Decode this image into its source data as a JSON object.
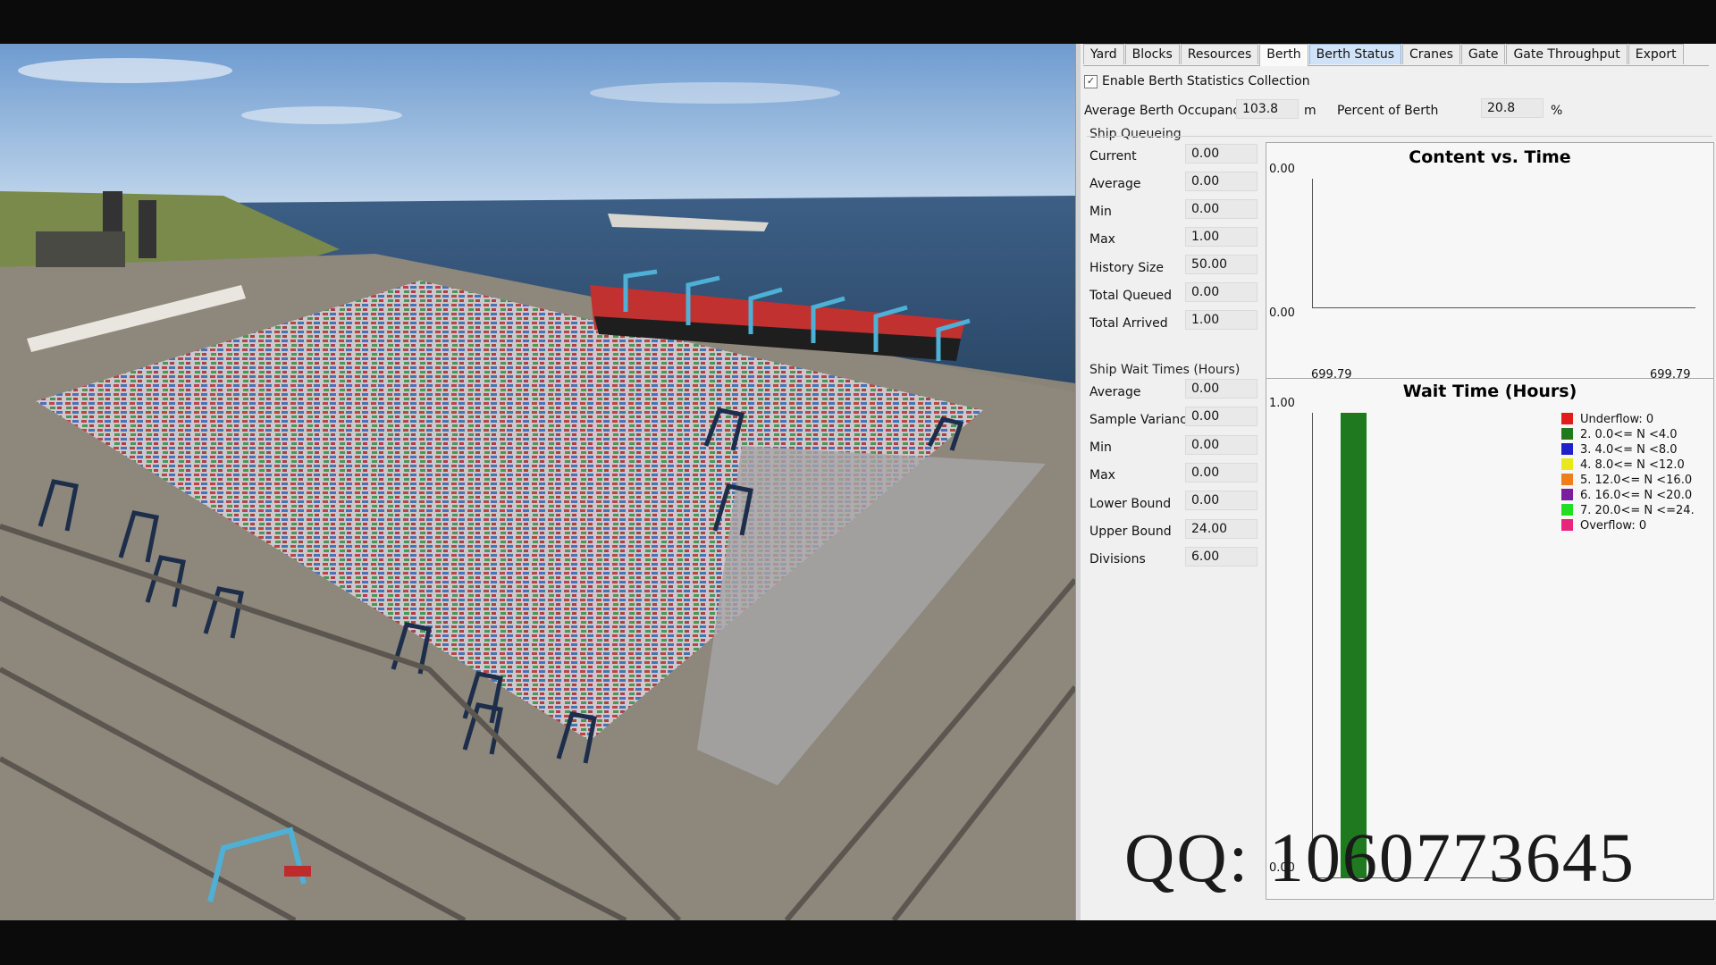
{
  "tabs": [
    {
      "label": "Yard"
    },
    {
      "label": "Blocks"
    },
    {
      "label": "Resources"
    },
    {
      "label": "Berth"
    },
    {
      "label": "Berth Status"
    },
    {
      "label": "Cranes"
    },
    {
      "label": "Gate"
    },
    {
      "label": "Gate Throughput"
    },
    {
      "label": "Export"
    }
  ],
  "enable": {
    "checked_glyph": "✓",
    "label": "Enable Berth Statistics Collection"
  },
  "occupancy": {
    "label": "Average Berth Occupancy",
    "value": "103.8",
    "unit": "m",
    "percent_label": "Percent of Berth",
    "percent_value": "20.8",
    "percent_unit": "%"
  },
  "queueing": {
    "title": "Ship Queueing",
    "rows": [
      {
        "label": "Current",
        "value": "0.00"
      },
      {
        "label": "Average",
        "value": "0.00"
      },
      {
        "label": "Min",
        "value": "0.00"
      },
      {
        "label": "Max",
        "value": "1.00"
      },
      {
        "label": "History Size",
        "value": "50.00"
      },
      {
        "label": "Total Queued",
        "value": "0.00"
      },
      {
        "label": "Total Arrived",
        "value": "1.00"
      }
    ]
  },
  "wait": {
    "title": "Ship Wait Times (Hours)",
    "rows": [
      {
        "label": "Average",
        "value": "0.00"
      },
      {
        "label": "Sample Variance",
        "value": "0.00"
      },
      {
        "label": "Min",
        "value": "0.00"
      },
      {
        "label": "Max",
        "value": "0.00"
      },
      {
        "label": "Lower Bound",
        "value": "0.00"
      },
      {
        "label": "Upper Bound",
        "value": "24.00"
      },
      {
        "label": "Divisions",
        "value": "6.00"
      }
    ]
  },
  "chart_data": [
    {
      "type": "line",
      "title": "Content vs. Time",
      "ytick_labels": [
        "0.00",
        "0.00"
      ],
      "xtick_labels": [
        "699.79",
        "699.79"
      ],
      "x": [
        699.79,
        699.79
      ],
      "y": [
        0,
        0
      ]
    },
    {
      "type": "bar",
      "title": "Wait Time (Hours)",
      "ytick_labels": [
        "1.00",
        "0.00"
      ],
      "ylim": [
        0,
        1
      ],
      "categories": [
        "Underflow: 0",
        "2. 0.0<= N <4.0",
        "3. 4.0<= N <8.0",
        "4. 8.0<= N <12.0",
        "5. 12.0<= N <16.0",
        "6. 16.0<= N <20.0",
        "7. 20.0<= N <=24.",
        "Overflow: 0"
      ],
      "colors": [
        "#e41a1c",
        "#1f7a1f",
        "#1f1fd0",
        "#e8e81a",
        "#ee7f1a",
        "#7a1f9a",
        "#22dd22",
        "#e8247c"
      ],
      "values": [
        0,
        1,
        0,
        0,
        0,
        0,
        0,
        0
      ]
    }
  ],
  "watermark": "QQ:  1060773645"
}
